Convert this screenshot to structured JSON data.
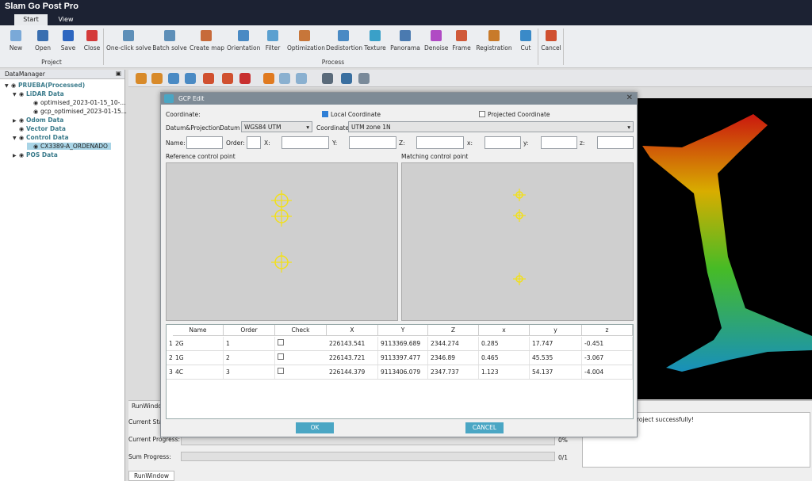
{
  "app": {
    "title": "Slam Go Post Pro"
  },
  "tabs": [
    "Start",
    "View"
  ],
  "ribbon": {
    "project_group": "Project",
    "process_group": "Process",
    "project_buttons": [
      "New",
      "Open",
      "Save",
      "Close"
    ],
    "process_buttons": [
      "One-click solve",
      "Batch solve",
      "Create map",
      "Orientation",
      "Filter",
      "Optimization",
      "Dedistortion",
      "Texture",
      "Panorama",
      "Denoise",
      "Frame",
      "Registration",
      "Cut",
      "Cancel"
    ]
  },
  "data_manager": {
    "title": "DataManager",
    "items": [
      {
        "label": "PRUEBA(Processed)",
        "bold": true
      },
      {
        "label": "LiDAR Data",
        "bold": true
      },
      {
        "label": "optimised_2023-01-15_10-...",
        "bold": false
      },
      {
        "label": "gcp_optimised_2023-01-15...",
        "bold": false
      },
      {
        "label": "Odom Data",
        "bold": true
      },
      {
        "label": "Vector Data",
        "bold": true
      },
      {
        "label": "Control Data",
        "bold": true
      },
      {
        "label": "CX3389-A_ORDENADO",
        "bold": false
      },
      {
        "label": "POS Data",
        "bold": true
      }
    ]
  },
  "run": {
    "title": "RunWindow",
    "current_status": "Current Sta",
    "current_progress": "Current Progress:",
    "current_pct": "0%",
    "sum_progress": "Sum Progress:",
    "sum_value": "0/1",
    "message": "roject successfully!",
    "tab": "RunWindow"
  },
  "dialog": {
    "title": "GCP Edit",
    "coordinate_label": "Coordinate:",
    "local": "Local Coordinate",
    "projected": "Projected Coordinate",
    "datum_proj_label": "Datum&Projection:",
    "datum_label": "Datum",
    "datum_value": "WGS84 UTM",
    "coord_label": "Coordinate",
    "coord_value": "UTM zone 1N",
    "name_label": "Name:",
    "order_label": "Order:",
    "x_label": "X:",
    "y_label": "Y:",
    "z_label": "Z:",
    "lx_label": "x:",
    "ly_label": "y:",
    "lz_label": "z:",
    "ref_panel": "Reference control point",
    "match_panel": "Matching control point",
    "columns": [
      "Name",
      "Order",
      "Check",
      "X",
      "Y",
      "Z",
      "x",
      "y",
      "z"
    ],
    "rows": [
      {
        "idx": "1",
        "name": "2G",
        "order": "1",
        "X": "226143.541",
        "Y": "9113369.689",
        "Z": "2344.274",
        "x": "0.285",
        "y": "17.747",
        "z": "-0.451"
      },
      {
        "idx": "2",
        "name": "1G",
        "order": "2",
        "X": "226143.721",
        "Y": "9113397.477",
        "Z": "2346.89",
        "x": "0.465",
        "y": "45.535",
        "z": "-3.067"
      },
      {
        "idx": "3",
        "name": "4C",
        "order": "3",
        "X": "226144.379",
        "Y": "9113406.079",
        "Z": "2347.737",
        "x": "1.123",
        "y": "54.137",
        "z": "-4.004"
      }
    ],
    "ok": "OK",
    "cancel": "CANCEL"
  },
  "colors": {
    "accent": "#4aa6c4",
    "title_bg": "#1c2233",
    "marker": "#f2e01a"
  }
}
